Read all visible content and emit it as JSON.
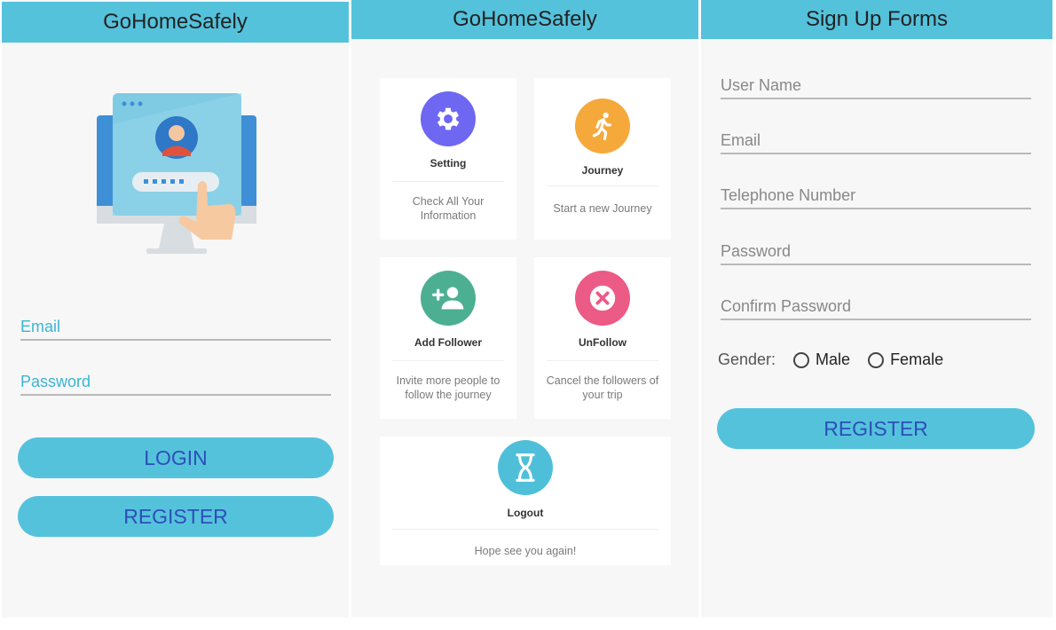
{
  "login_screen": {
    "title": "GoHomeSafely",
    "email_placeholder": "Email",
    "password_placeholder": "Password",
    "login_label": "LOGIN",
    "register_label": "REGISTER"
  },
  "menu_screen": {
    "title": "GoHomeSafely",
    "cards": [
      {
        "title": "Setting",
        "description": "Check All Your Information",
        "icon": "gear-icon",
        "color": "#6e67f2"
      },
      {
        "title": "Journey",
        "description": "Start a new Journey",
        "icon": "walking-person-icon",
        "color": "#f5a93b"
      },
      {
        "title": "Add Follower",
        "description": "Invite more people to follow the journey",
        "icon": "add-person-icon",
        "color": "#4daf92"
      },
      {
        "title": "UnFollow",
        "description": "Cancel the followers of your trip",
        "icon": "close-circle-icon",
        "color": "#ec5a86"
      },
      {
        "title": "Logout",
        "description": "Hope see you again!",
        "icon": "hourglass-icon",
        "color": "#4fbfd9"
      }
    ]
  },
  "signup_screen": {
    "title": "Sign Up Forms",
    "fields": [
      "User Name",
      "Email",
      "Telephone Number",
      "Password",
      "Confirm Password"
    ],
    "gender_label": "Gender:",
    "gender_options": [
      "Male",
      "Female"
    ],
    "register_label": "REGISTER"
  },
  "colors": {
    "appbar": "#55c2dc",
    "button_text": "#2c4fb8",
    "background": "#f7f7f7"
  }
}
